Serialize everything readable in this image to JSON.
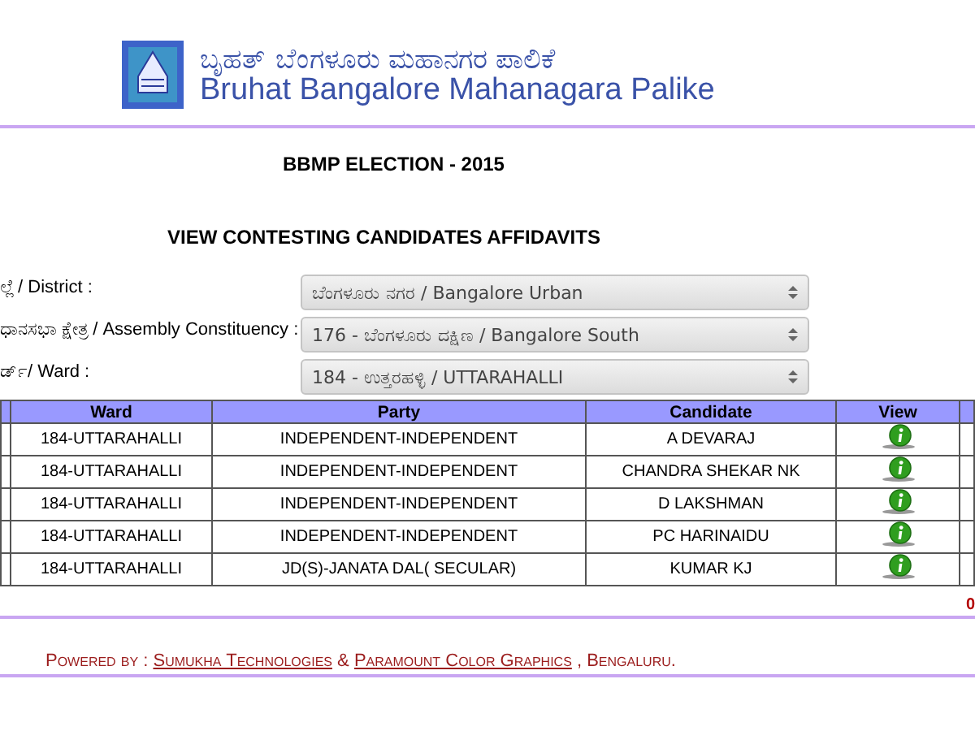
{
  "header": {
    "title_kannada": "ಬೃಹತ್ ಬೆಂಗಳೂರು ಮಹಾನಗರ ಪಾಲಿಕೆ",
    "title_english": "Bruhat Bangalore Mahanagara Palike"
  },
  "election_title": "BBMP ELECTION - 2015",
  "page_title": "VIEW CONTESTING CANDIDATES AFFIDAVITS",
  "filters": [
    {
      "label": "ಲ್ಲೆ / District :",
      "value": "ಬೆಂಗಳೂರು ನಗರ / Bangalore Urban"
    },
    {
      "label": "ಧಾನಸಭಾ ಕ್ಷೇತ್ರ / Assembly Constituency :",
      "value": "176 - ಬೆಂಗಳೂರು ದಕ್ಷಿಣ / Bangalore South"
    },
    {
      "label": "ರ್ಡ್/ Ward :",
      "value": "184 - ಉತ್ತರಹಳ್ಳಿ / UTTARAHALLI"
    }
  ],
  "table": {
    "columns": [
      "Ward",
      "Party",
      "Candidate",
      "View"
    ],
    "rows": [
      {
        "ward": "184-UTTARAHALLI",
        "party": "INDEPENDENT-INDEPENDENT",
        "candidate": "A DEVARAJ"
      },
      {
        "ward": "184-UTTARAHALLI",
        "party": "INDEPENDENT-INDEPENDENT",
        "candidate": "CHANDRA SHEKAR NK"
      },
      {
        "ward": "184-UTTARAHALLI",
        "party": "INDEPENDENT-INDEPENDENT",
        "candidate": "D LAKSHMAN"
      },
      {
        "ward": "184-UTTARAHALLI",
        "party": "INDEPENDENT-INDEPENDENT",
        "candidate": "PC HARINAIDU"
      },
      {
        "ward": "184-UTTARAHALLI",
        "party": "JD(S)-JANATA DAL( SECULAR)",
        "candidate": "KUMAR KJ"
      }
    ]
  },
  "counter": "0",
  "footer": {
    "prefix": "Powered by : ",
    "link_1": "Sumukha Technologies",
    "joiner": " & ",
    "link_2": "Paramount Color Graphics",
    "suffix": " , Bengaluru."
  }
}
